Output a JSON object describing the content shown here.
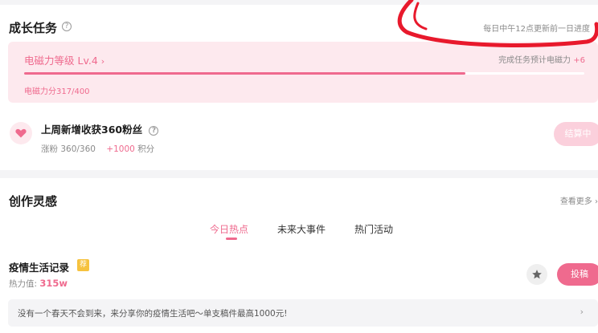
{
  "growth": {
    "title": "成长任务",
    "help_icon": "question-circle-icon",
    "update_note": "每日中午12点更新前一日进度",
    "level": {
      "title": "电磁力等级 Lv.4",
      "chevron": "›",
      "estimate_label": "完成任务预计电磁力",
      "estimate_value": "+6",
      "score_text": "电磁力分317/400",
      "progress": 0.788
    },
    "task": {
      "icon": "heart-icon",
      "title": "上周新增收获360粉丝",
      "fans_text": "涨粉 360/360",
      "bonus_value": "+1000",
      "bonus_unit": "积分",
      "button": "结算中"
    }
  },
  "inspiration": {
    "title": "创作灵感",
    "more_link": "查看更多 ›",
    "tabs": [
      {
        "label": "今日热点",
        "active": true
      },
      {
        "label": "未来大事件",
        "active": false
      },
      {
        "label": "热门活动",
        "active": false
      }
    ],
    "topic": {
      "title": "疫情生活记录",
      "tag": "荐",
      "heat_label": "热力值:",
      "heat_value": "315w",
      "favorite_icon": "star-icon",
      "submit_button": "投稿"
    },
    "promo": {
      "text": "没有一个春天不会到来，来分享你的疫情生活吧～单支稿件最高1000元!",
      "chevron": "›"
    }
  },
  "colors": {
    "accent": "#ef6a8e",
    "accent_light": "#fde9ee",
    "button_disabled": "#fbd0dc",
    "tag_yellow": "#f6c23e",
    "annotation_red": "#e8192c"
  }
}
